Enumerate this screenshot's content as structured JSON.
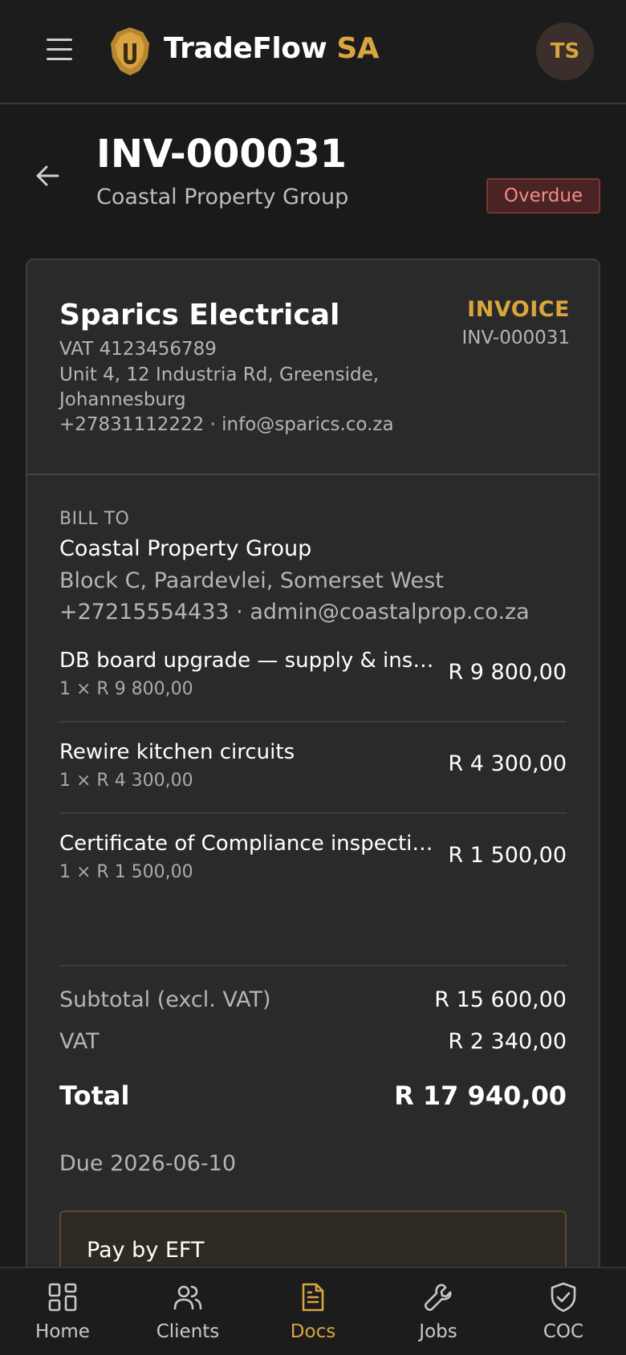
{
  "app": {
    "brand_main": "TradeFlow",
    "brand_suffix": "SA",
    "user_initials": "TS",
    "accent_color": "#d9a53f"
  },
  "header": {
    "invoice_number": "INV-000031",
    "client_name": "Coastal Property Group",
    "status": "Overdue",
    "status_color": "#f28a8a"
  },
  "issuer": {
    "company": "Sparics Electrical",
    "vat": "VAT 4123456789",
    "address_line1": "Unit 4, 12 Industria Rd, Greenside,",
    "address_line2": "Johannesburg",
    "contact": "+27831112222 · info@sparics.co.za"
  },
  "document": {
    "type": "INVOICE",
    "number": "INV-000031"
  },
  "bill_to": {
    "label": "BILL TO",
    "name": "Coastal Property Group",
    "address": "Block C, Paardevlei, Somerset West",
    "contact": "+27215554433 · admin@coastalprop.co.za"
  },
  "line_items": [
    {
      "description": "DB board upgrade — supply & install",
      "qty_line": "1 × R 9 800,00",
      "amount": "R 9 800,00"
    },
    {
      "description": "Rewire kitchen circuits",
      "qty_line": "1 × R 4 300,00",
      "amount": "R 4 300,00"
    },
    {
      "description": "Certificate of Compliance inspection",
      "qty_line": "1 × R 1 500,00",
      "amount": "R 1 500,00"
    }
  ],
  "totals": {
    "subtotal_label": "Subtotal (excl. VAT)",
    "subtotal": "R 15 600,00",
    "vat_label": "VAT",
    "vat": "R 2 340,00",
    "total_label": "Total",
    "total": "R 17 940,00"
  },
  "due": "Due 2026-06-10",
  "payment": {
    "title": "Pay by EFT"
  },
  "nav": [
    {
      "label": "Home",
      "icon": "grid-icon",
      "active": false
    },
    {
      "label": "Clients",
      "icon": "users-icon",
      "active": false
    },
    {
      "label": "Docs",
      "icon": "document-icon",
      "active": true
    },
    {
      "label": "Jobs",
      "icon": "wrench-icon",
      "active": false
    },
    {
      "label": "COC",
      "icon": "shield-check-icon",
      "active": false
    }
  ]
}
